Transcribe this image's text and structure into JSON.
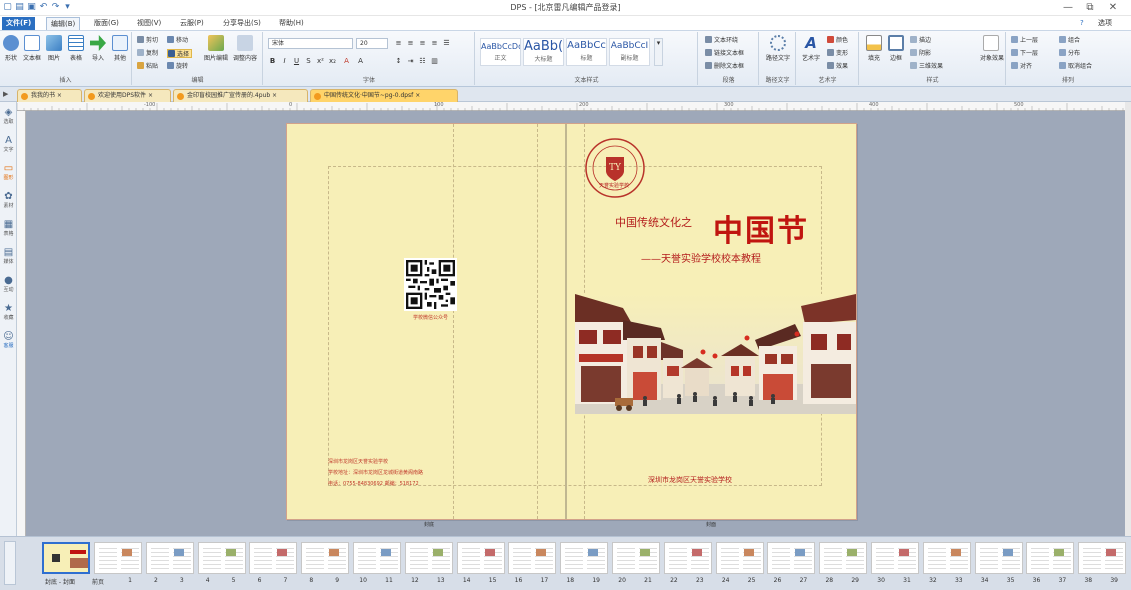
{
  "titlebar": {
    "title": "DPS - [北京雷凡编辑产品登录]",
    "qa_icons": [
      "new-icon",
      "open-icon",
      "save-icon",
      "undo-icon",
      "redo-icon",
      "dropdown-icon"
    ],
    "controls": {
      "min": "—",
      "max": "⧉",
      "close": "✕"
    }
  },
  "menubar": {
    "items": [
      {
        "label": "文件(F)",
        "name": "menu-file"
      },
      {
        "label": "编辑(B)",
        "name": "menu-edit",
        "active": true
      },
      {
        "label": "版面(G)",
        "name": "menu-layout"
      },
      {
        "label": "视图(V)",
        "name": "menu-view"
      },
      {
        "label": "云服(P)",
        "name": "menu-cloud"
      },
      {
        "label": "分享导出(S)",
        "name": "menu-share"
      },
      {
        "label": "帮助(H)",
        "name": "menu-help"
      }
    ],
    "right": "选项"
  },
  "ribbon": {
    "insert": {
      "label": "插入",
      "buttons": [
        "形状",
        "文本框",
        "图片",
        "表格",
        "导入",
        "其他"
      ]
    },
    "edit": {
      "label": "编辑",
      "items": [
        "剪切",
        "复制",
        "粘贴",
        "移动",
        "选择",
        "旋转"
      ],
      "big": [
        "图片编辑",
        "调整内容"
      ]
    },
    "font": {
      "label": "字体",
      "fontname": "宋体",
      "fontsize": "20"
    },
    "textstyle": {
      "label": "文本样式",
      "styles": [
        {
          "sample": "AaBbCcDd",
          "name": "正文",
          "size": 8
        },
        {
          "sample": "AaBb(",
          "name": "大标题",
          "size": 14
        },
        {
          "sample": "AaBbCc",
          "name": "标题",
          "size": 10
        },
        {
          "sample": "AaBbCcI",
          "name": "副标题",
          "size": 9
        }
      ]
    },
    "paragraph": {
      "label": "段落",
      "items": [
        "文本环绕",
        "链接文本框",
        "删除文本框"
      ]
    },
    "pathtext": {
      "label": "路径文字",
      "button": "路径文字"
    },
    "arttext": {
      "label": "艺术字",
      "items": [
        "艺术字",
        "颜色",
        "变形",
        "效果"
      ]
    },
    "style": {
      "label": "样式",
      "items": [
        "填充",
        "边框",
        "描边",
        "阴影",
        "三维效果",
        "对象效果"
      ]
    },
    "arrange": {
      "label": "排列",
      "items": [
        "上一层",
        "下一层",
        "对齐",
        "组合",
        "分布",
        "取消组合"
      ]
    }
  },
  "tabs": [
    {
      "label": "我我的书 ×",
      "name": "tab-1"
    },
    {
      "label": "欢迎使用DPS软件 ×",
      "name": "tab-2"
    },
    {
      "label": "金印盲校园推广宣传册的.4pub ×",
      "name": "tab-3"
    },
    {
      "label": "中国传统文化·中国节~pg-0.dpsf ×",
      "name": "tab-4",
      "active": true
    }
  ],
  "tools": [
    {
      "label": "选取",
      "icon": "◈"
    },
    {
      "label": "文字",
      "icon": "A"
    },
    {
      "label": "图形",
      "icon": "▭",
      "on": true
    },
    {
      "label": "素材",
      "icon": "✿"
    },
    {
      "label": "表格",
      "icon": "▦"
    },
    {
      "label": "媒体",
      "icon": "▤"
    },
    {
      "label": "互动",
      "icon": "●"
    },
    {
      "label": "收藏",
      "icon": "★"
    },
    {
      "label": "客服",
      "icon": "☺"
    }
  ],
  "ruler": {
    "h": [
      "-100",
      "0",
      "100",
      "200",
      "300",
      "400",
      "500",
      "600"
    ],
    "v": [
      "-100",
      "0",
      "100",
      "200"
    ]
  },
  "document": {
    "seal_text": "天誉实验学校",
    "title_prefix": "中国传统文化之",
    "title_main": "中国节",
    "subtitle": "——天誉实验学校校本教程",
    "qr_caption": "学校微信公众号",
    "back_lines": [
      "深圳市龙岗区天誉实验学校",
      "学校地址：深圳市龙岗区龙城街道黄阁南路",
      "电话：0755-84830692  邮编：518172"
    ],
    "bottom_right": "深圳市龙岗区天誉实验学校",
    "page_labels": [
      "封底",
      "封面"
    ]
  },
  "thumbs": {
    "label_first": "封底 - 封面",
    "label_second": "前页",
    "numbers": [
      "1",
      "2",
      "3",
      "4",
      "5",
      "6",
      "7",
      "8",
      "9",
      "10",
      "11",
      "12",
      "13",
      "14",
      "15",
      "16",
      "17",
      "18",
      "19",
      "20",
      "21",
      "22",
      "23",
      "24",
      "25",
      "26",
      "27",
      "28",
      "29",
      "30",
      "31",
      "32",
      "33",
      "34",
      "35",
      "36",
      "37",
      "38",
      "39"
    ]
  }
}
